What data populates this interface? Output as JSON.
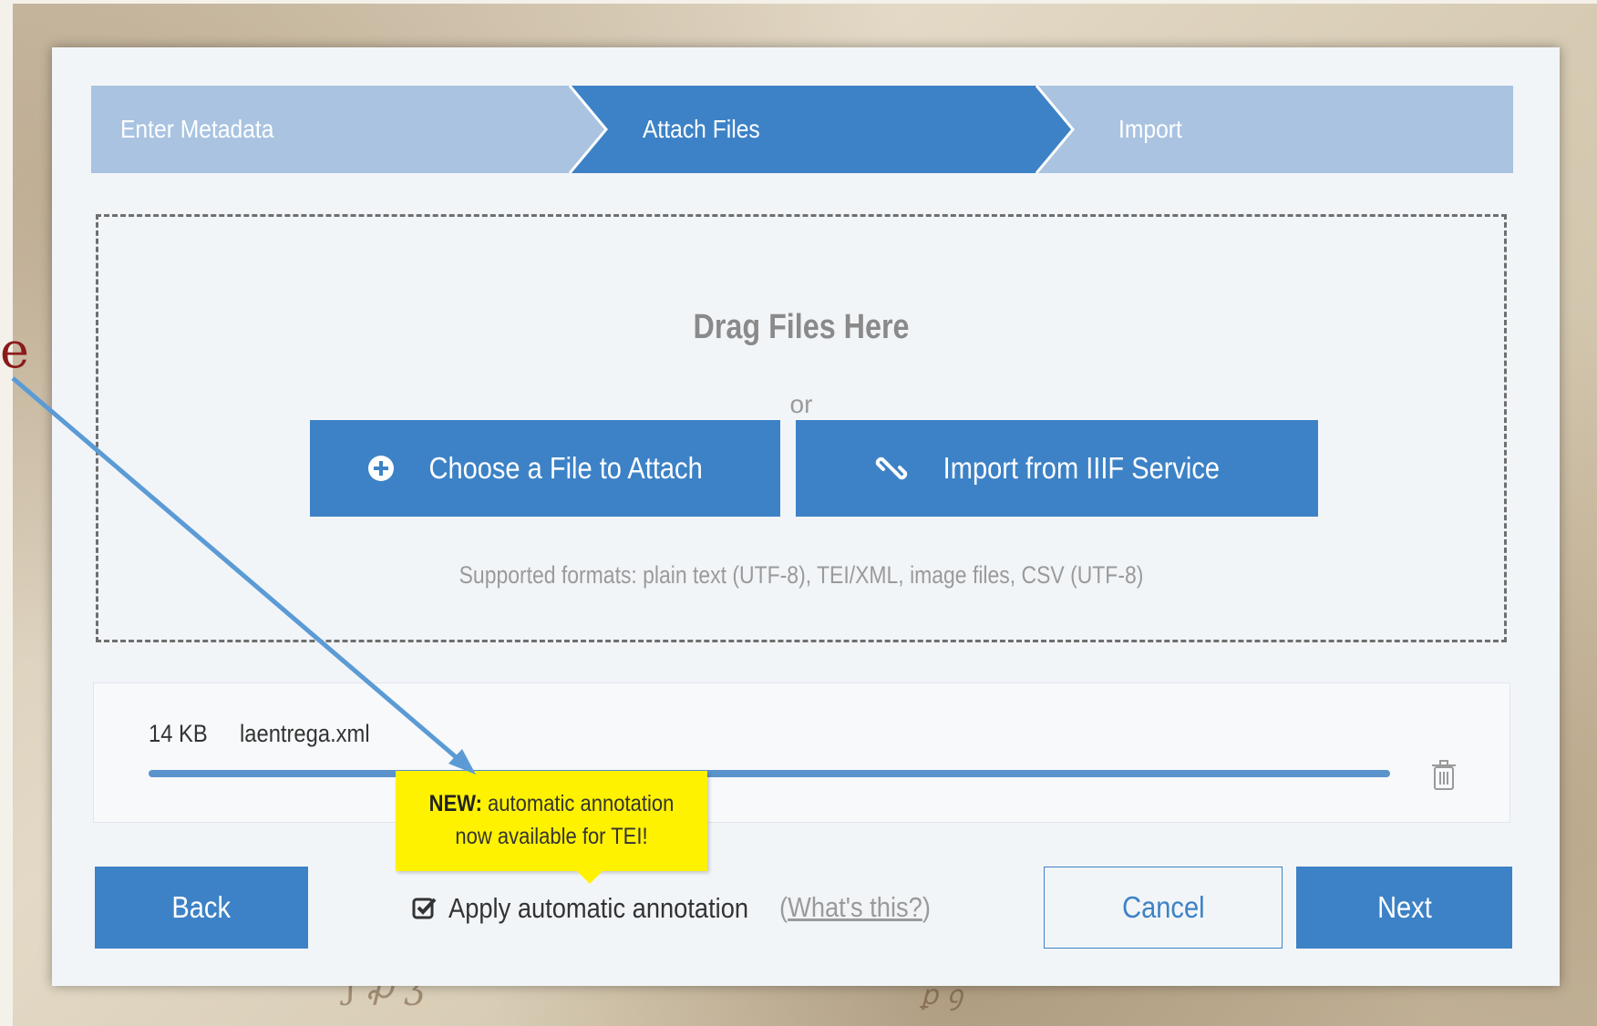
{
  "steps": [
    {
      "label": "Enter Metadata",
      "state": "done"
    },
    {
      "label": "Attach Files",
      "state": "active"
    },
    {
      "label": "Import",
      "state": "pending"
    }
  ],
  "dropzone": {
    "title": "Drag Files Here",
    "or": "or",
    "choose_label": "Choose a File to Attach",
    "iiif_label": "Import from IIIF Service",
    "formats": "Supported formats: plain text (UTF-8), TEI/XML, image files, CSV (UTF-8)"
  },
  "file": {
    "size": "14 KB",
    "name": "laentrega.xml",
    "progress": 1.0
  },
  "tooltip": {
    "lead": "NEW:",
    "line1": "automatic annotation",
    "line2": "now available for TEI!"
  },
  "footer": {
    "back_label": "Back",
    "auto_annotation_label": "Apply automatic annotation",
    "whats_this_open": "(",
    "whats_this_link": "What's this?",
    "whats_this_close": ")",
    "cancel_label": "Cancel",
    "next_label": "Next"
  },
  "colors": {
    "primary": "#3d82c6",
    "step_light": "#a9c3e1",
    "tooltip": "#fff200",
    "callout_arrow": "#5b9bd5"
  },
  "icons": {
    "choose": "circle-plus-icon",
    "iiif": "link-icon",
    "delete": "trash-icon",
    "checkbox": "checked-checkbox-icon"
  }
}
